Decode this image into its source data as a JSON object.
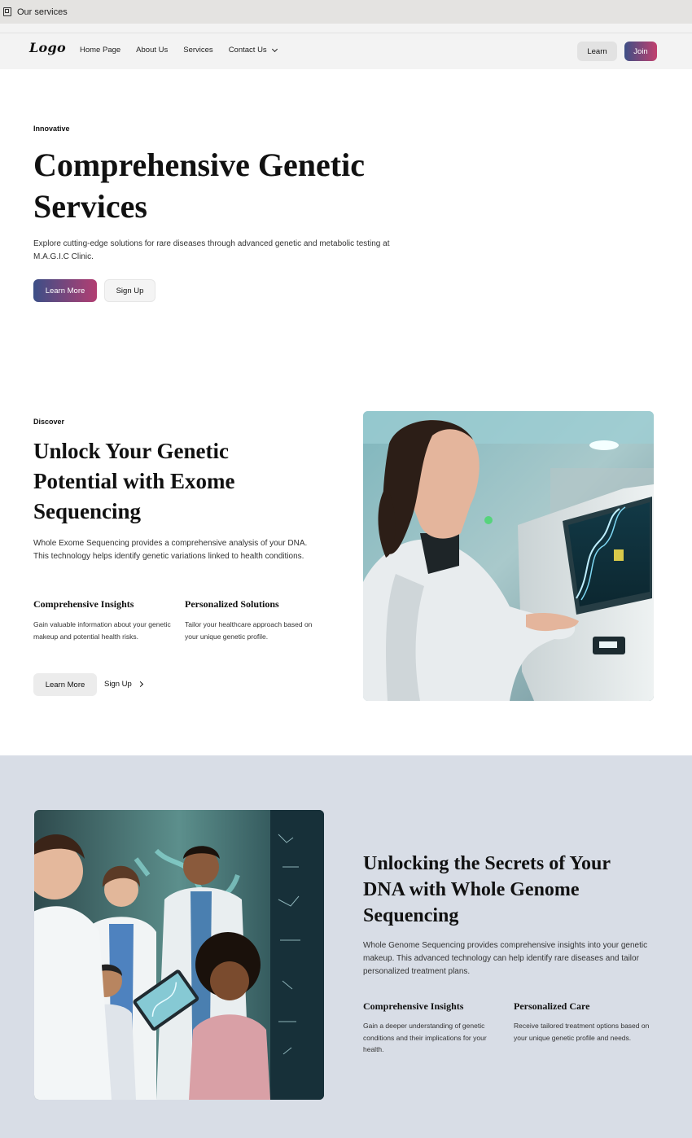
{
  "tab": {
    "title": "Our services",
    "icon": "browser-tab-icon"
  },
  "nav": {
    "logo": "Logo",
    "links": [
      "Home Page",
      "About Us",
      "Services",
      "Contact Us"
    ],
    "learn_label": "Learn",
    "join_label": "Join"
  },
  "hero": {
    "eyebrow": "Innovative",
    "title": "Comprehensive Genetic Services",
    "description": "Explore cutting-edge solutions for rare diseases through advanced genetic and metabolic testing at M.A.G.I.C Clinic.",
    "primary_label": "Learn More",
    "secondary_label": "Sign Up"
  },
  "exome": {
    "eyebrow": "Discover",
    "title": "Unlock Your Genetic Potential with Exome Sequencing",
    "description": "Whole Exome Sequencing provides a comprehensive analysis of your DNA. This technology helps identify genetic variations linked to health conditions.",
    "features": [
      {
        "title": "Comprehensive Insights",
        "text": "Gain valuable information about your genetic makeup and potential health risks."
      },
      {
        "title": "Personalized Solutions",
        "text": "Tailor your healthcare approach based on your unique genetic profile."
      }
    ],
    "learn_label": "Learn More",
    "signup_label": "Sign Up",
    "image_icon": "scientist-lab-image"
  },
  "genome": {
    "title": "Unlocking the Secrets of Your DNA with Whole Genome Sequencing",
    "description": "Whole Genome Sequencing provides comprehensive insights into your genetic makeup. This advanced technology can help identify rare diseases and tailor personalized treatment plans.",
    "features": [
      {
        "title": "Comprehensive Insights",
        "text": "Gain a deeper understanding of genetic conditions and their implications for your health."
      },
      {
        "title": "Personalized Care",
        "text": "Receive tailored treatment options based on your unique genetic profile and needs."
      }
    ],
    "image_icon": "family-doctors-image"
  },
  "colors": {
    "accent_start": "#3c4f87",
    "accent_end": "#c2406e",
    "section_bg": "#d8dde6",
    "nav_bg": "#f3f3f3"
  }
}
